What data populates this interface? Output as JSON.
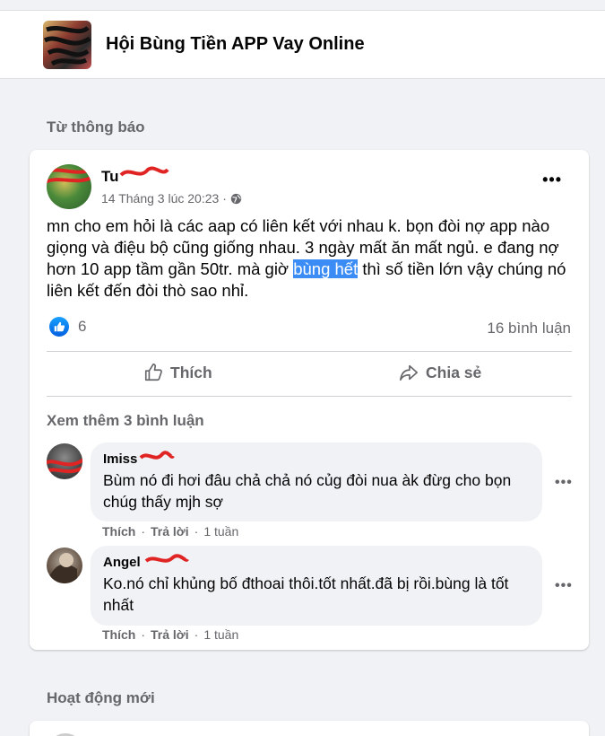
{
  "group": {
    "name": "Hội Bùng Tiền APP Vay Online"
  },
  "sections": {
    "notification": "Từ thông báo",
    "recent": "Hoạt động mới"
  },
  "post": {
    "author": "Tu",
    "timestamp": "14 Tháng 3 lúc 20:23",
    "dot": "·",
    "text_before": "mn cho em hỏi là các aap có liên kết với nhau k. bọn đòi nợ app nào giọng và điệu bộ cũng giống nhau. 3 ngày mất ăn mất ngủ. e đang nợ hơn 10 app tầm gần 50tr. mà giờ ",
    "text_highlight": "bùng hết",
    "text_after": " thì số tiền lớn vậy chúng nó liên kết đến đòi thò sao nhỉ.",
    "reaction_count": "6",
    "comment_count": "16 bình luận",
    "like_label": "Thích",
    "share_label": "Chia sẻ",
    "more": "•••"
  },
  "comments_header": "Xem thêm 3 bình luận",
  "comments": [
    {
      "name": "Imiss",
      "text": "Bùm nó đi hơi đâu chả chả nó củg đòi nua àk đừg cho bọn chúg thấy mjh sợ",
      "like": "Thích",
      "reply": "Trả lời",
      "time": "1 tuần",
      "more": "•••"
    },
    {
      "name": "Angel",
      "text": "Ko.nó chỉ khủng bố đthoai thôi.tốt nhất.đã bị rồi.bùng là tốt nhất",
      "like": "Thích",
      "reply": "Trả lời",
      "time": "1 tuần",
      "more": "•••"
    }
  ],
  "colors": {
    "accent": "#1877f2",
    "highlight": "#3b8cf5",
    "muted": "#65676b"
  }
}
